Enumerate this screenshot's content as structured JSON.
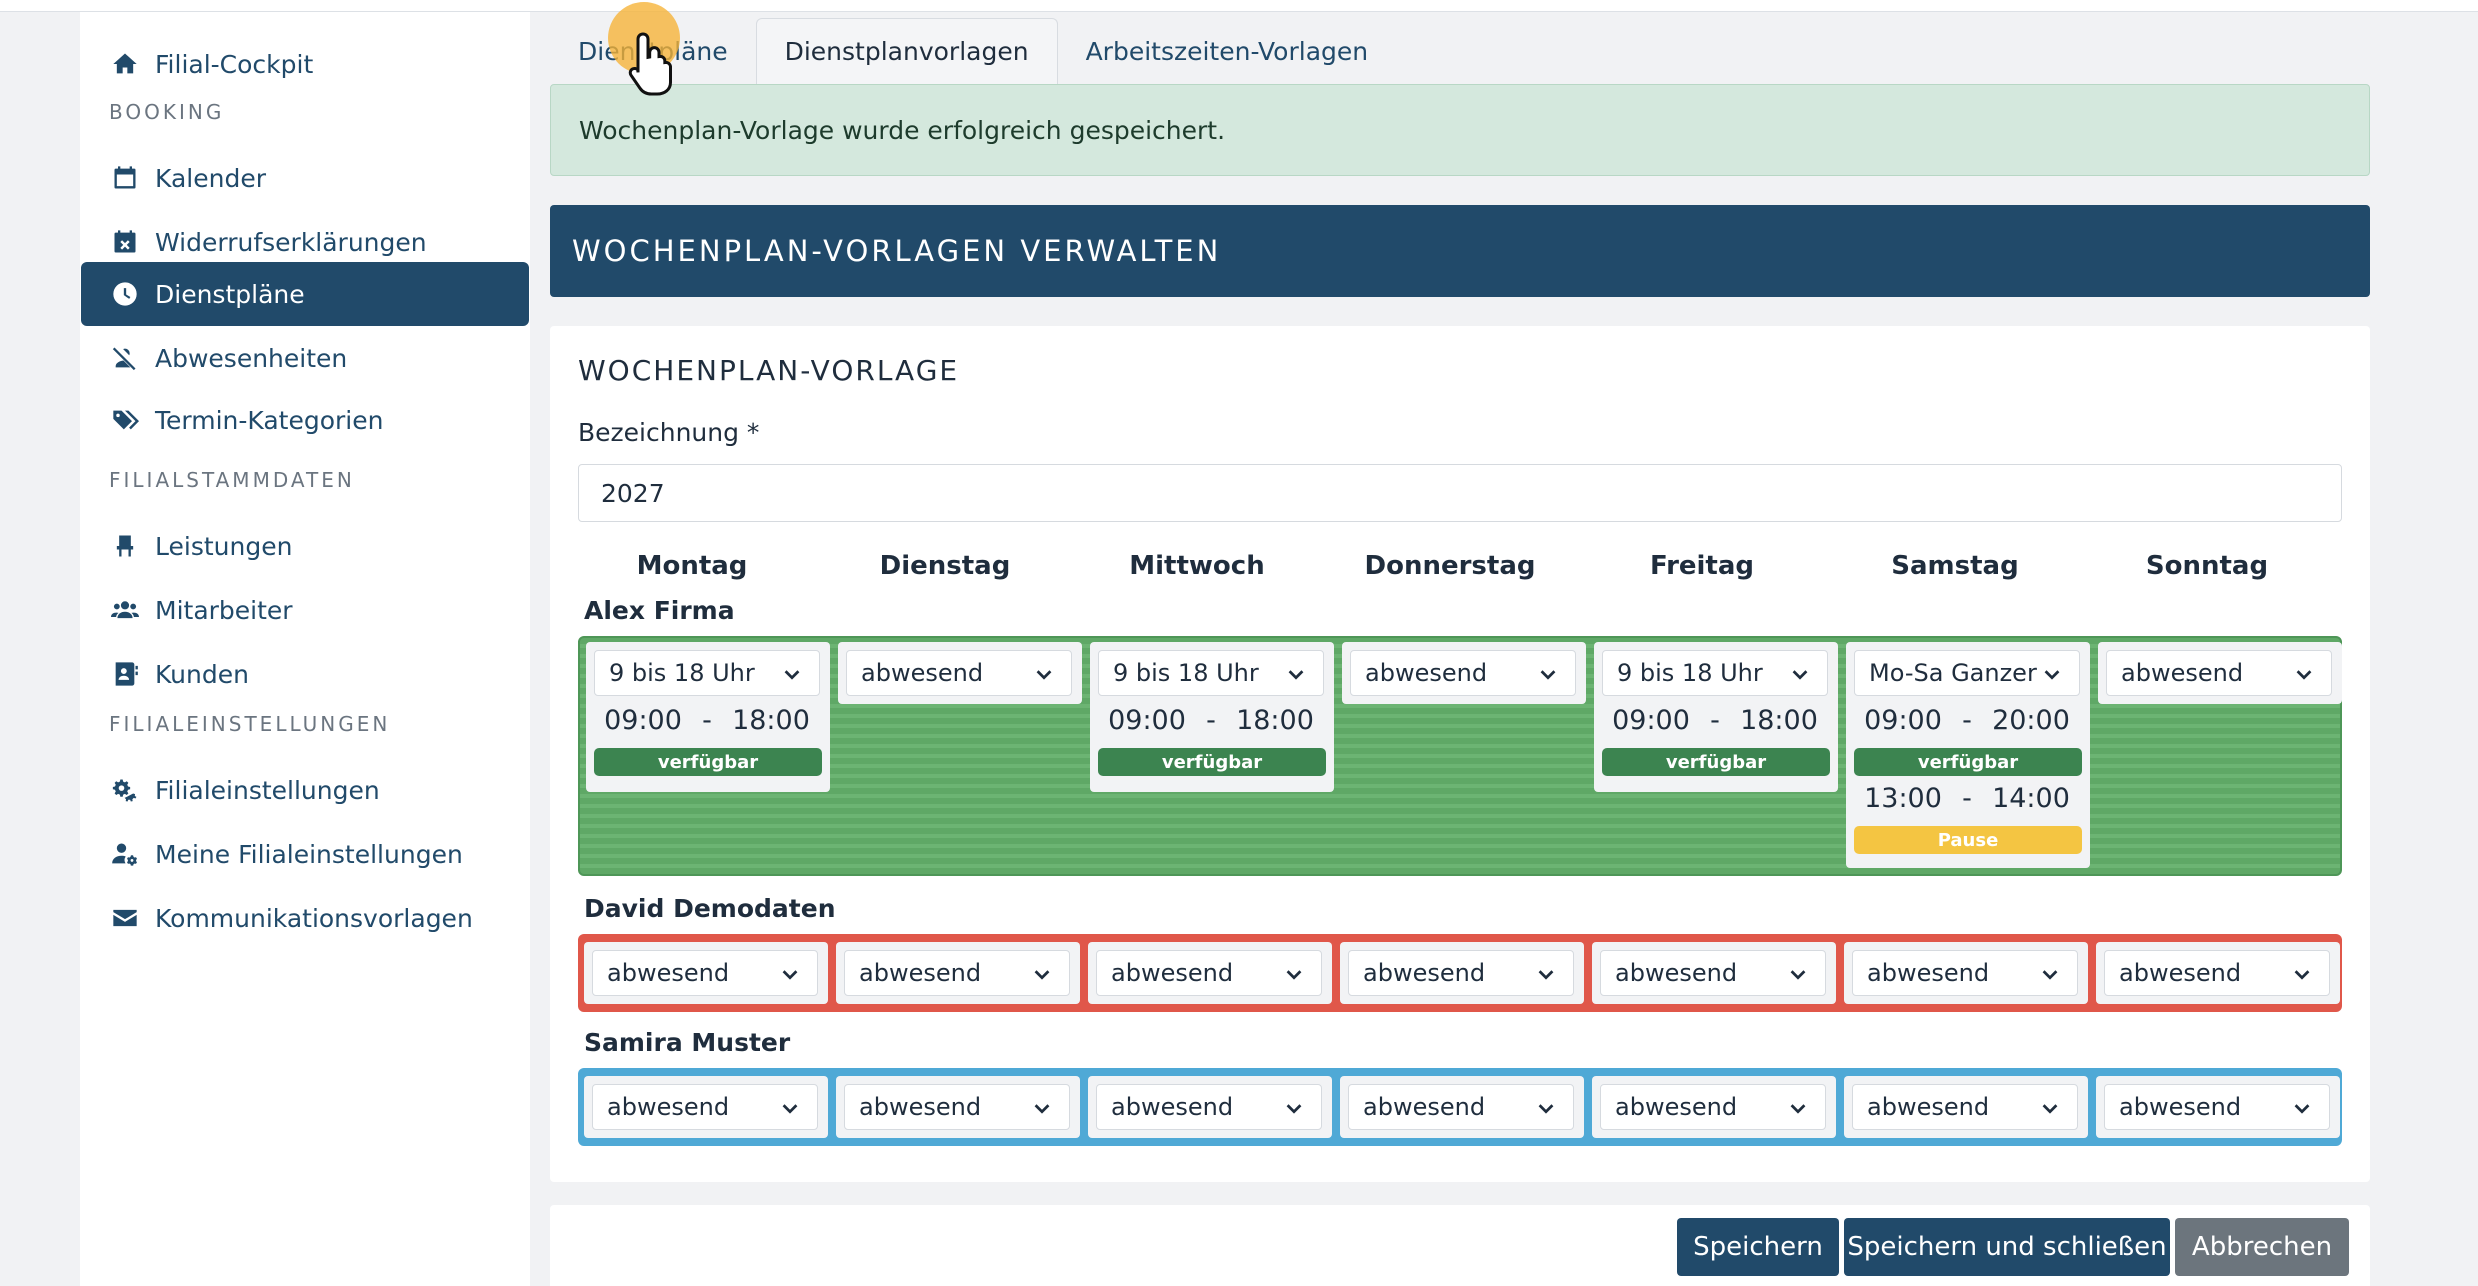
{
  "sidebar": {
    "items": [
      {
        "label": "Filial-Cockpit",
        "icon": "home-icon"
      },
      {
        "label": "Kalender",
        "icon": "calendar-icon"
      },
      {
        "label": "Widerrufserklärungen",
        "icon": "calendar-x-icon"
      },
      {
        "label": "Dienstpläne",
        "icon": "clock-icon",
        "active": true
      },
      {
        "label": "Abwesenheiten",
        "icon": "user-slash-icon"
      },
      {
        "label": "Termin-Kategorien",
        "icon": "tags-icon"
      },
      {
        "label": "Leistungen",
        "icon": "chair-icon"
      },
      {
        "label": "Mitarbeiter",
        "icon": "users-icon"
      },
      {
        "label": "Kunden",
        "icon": "address-book-icon"
      },
      {
        "label": "Filialeinstellungen",
        "icon": "gears-icon"
      },
      {
        "label": "Meine Filialeinstellungen",
        "icon": "user-gear-icon"
      },
      {
        "label": "Kommunikationsvorlagen",
        "icon": "envelope-icon"
      }
    ],
    "sections": [
      "BOOKING",
      "FILIALSTAMMDATEN",
      "FILIALEINSTELLUNGEN"
    ]
  },
  "tabs": [
    "Dienstpläne",
    "Dienstplanvorlagen",
    "Arbeitszeiten-Vorlagen"
  ],
  "active_tab": "Dienstplanvorlagen",
  "alert": "Wochenplan-Vorlage wurde erfolgreich gespeichert.",
  "header": "WOCHENPLAN-VORLAGEN VERWALTEN",
  "form": {
    "title": "WOCHENPLAN-VORLAGE",
    "label": "Bezeichnung *",
    "value": "2027"
  },
  "days": [
    "Montag",
    "Dienstag",
    "Mittwoch",
    "Donnerstag",
    "Freitag",
    "Samstag",
    "Sonntag"
  ],
  "employees": [
    {
      "name": "Alex Firma",
      "color": "#5fa866",
      "cells": [
        {
          "select": "9 bis 18 Uhr",
          "from": "09:00",
          "sep": "-",
          "to": "18:00",
          "status": "verfügbar"
        },
        {
          "select": "abwesend"
        },
        {
          "select": "9 bis 18 Uhr",
          "from": "09:00",
          "sep": "-",
          "to": "18:00",
          "status": "verfügbar"
        },
        {
          "select": "abwesend"
        },
        {
          "select": "9 bis 18 Uhr",
          "from": "09:00",
          "sep": "-",
          "to": "18:00",
          "status": "verfügbar"
        },
        {
          "select": "Mo-Sa Ganzer",
          "from": "09:00",
          "sep": "-",
          "to": "20:00",
          "status": "verfügbar",
          "pause_from": "13:00",
          "pause_sep": "-",
          "pause_to": "14:00",
          "pause_label": "Pause"
        },
        {
          "select": "abwesend"
        }
      ]
    },
    {
      "name": "David Demodaten",
      "color": "#e0574a",
      "cells": [
        {
          "select": "abwesend"
        },
        {
          "select": "abwesend"
        },
        {
          "select": "abwesend"
        },
        {
          "select": "abwesend"
        },
        {
          "select": "abwesend"
        },
        {
          "select": "abwesend"
        },
        {
          "select": "abwesend"
        }
      ]
    },
    {
      "name": "Samira Muster",
      "color": "#4fa9d6",
      "cells": [
        {
          "select": "abwesend"
        },
        {
          "select": "abwesend"
        },
        {
          "select": "abwesend"
        },
        {
          "select": "abwesend"
        },
        {
          "select": "abwesend"
        },
        {
          "select": "abwesend"
        },
        {
          "select": "abwesend"
        }
      ]
    }
  ],
  "buttons": {
    "save": "Speichern",
    "save_close": "Speichern und schließen",
    "cancel": "Abbrechen"
  }
}
